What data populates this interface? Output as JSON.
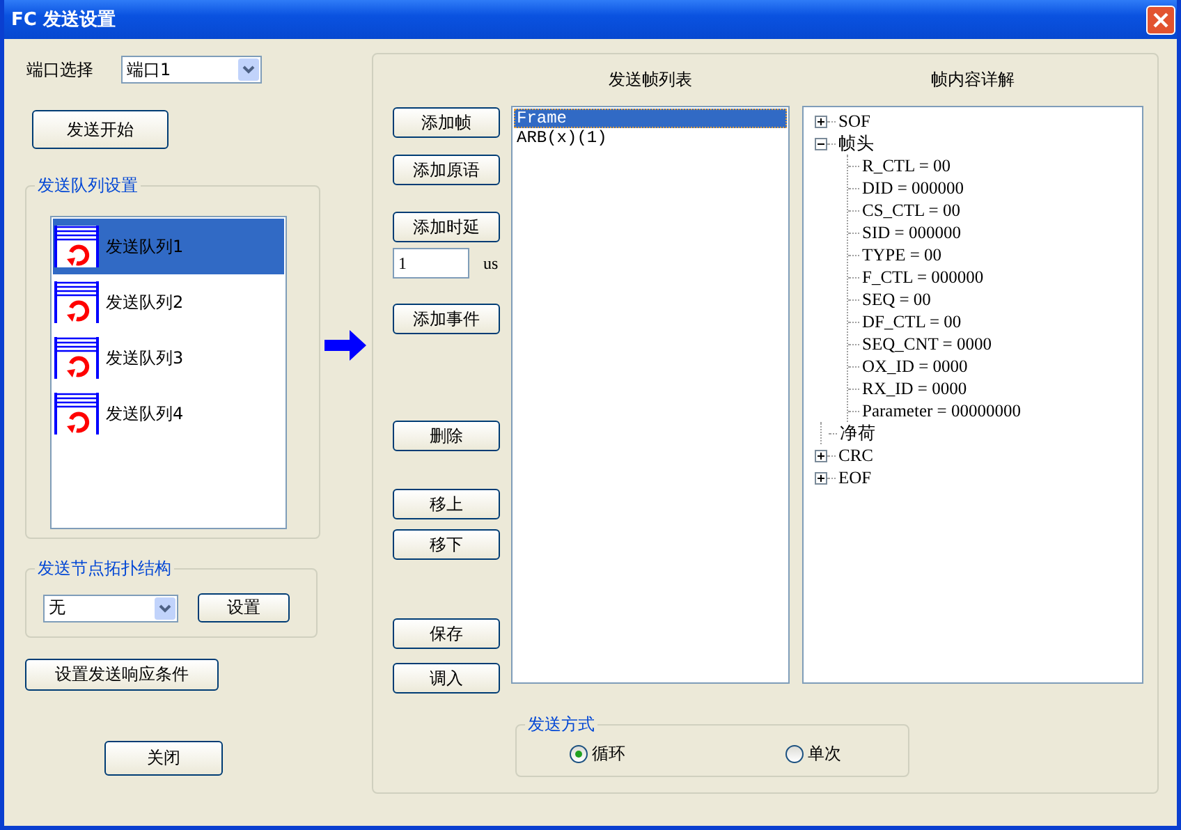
{
  "window": {
    "title": "FC 发送设置"
  },
  "port": {
    "label": "端口选择",
    "value": "端口1"
  },
  "start_button": "发送开始",
  "queue_group": {
    "title": "发送队列设置",
    "items": [
      {
        "label": "发送队列1",
        "selected": true
      },
      {
        "label": "发送队列2",
        "selected": false
      },
      {
        "label": "发送队列3",
        "selected": false
      },
      {
        "label": "发送队列4",
        "selected": false
      }
    ]
  },
  "topology_group": {
    "title": "发送节点拓扑结构",
    "value": "无",
    "button": "设置"
  },
  "response_button": "设置发送响应条件",
  "close_button": "关闭",
  "actions": [
    {
      "kind": "button",
      "label": "添加帧"
    },
    {
      "kind": "button",
      "label": "添加原语"
    },
    {
      "kind": "button",
      "label": "添加时延"
    },
    {
      "kind": "input",
      "value": "1",
      "unit": "us"
    },
    {
      "kind": "button",
      "label": "添加事件"
    },
    {
      "kind": "button",
      "label": "删除"
    },
    {
      "kind": "button",
      "label": "移上"
    },
    {
      "kind": "button",
      "label": "移下"
    },
    {
      "kind": "button",
      "label": "保存"
    },
    {
      "kind": "button",
      "label": "调入"
    }
  ],
  "frame_list": {
    "heading": "发送帧列表",
    "items": [
      {
        "label": "Frame",
        "selected": true
      },
      {
        "label": "ARB(x)(1)",
        "selected": false
      }
    ]
  },
  "frame_detail": {
    "heading": "帧内容详解",
    "tree": [
      {
        "kind": "folder",
        "label": "SOF",
        "expanded": false
      },
      {
        "kind": "folder",
        "label": "帧头",
        "expanded": true,
        "children": [
          {
            "label": "R_CTL = 00"
          },
          {
            "label": "DID = 000000"
          },
          {
            "label": "CS_CTL = 00"
          },
          {
            "label": "SID = 000000"
          },
          {
            "label": "TYPE = 00"
          },
          {
            "label": "F_CTL = 000000"
          },
          {
            "label": "SEQ = 00"
          },
          {
            "label": "DF_CTL = 00"
          },
          {
            "label": "SEQ_CNT = 0000"
          },
          {
            "label": "OX_ID = 0000"
          },
          {
            "label": "RX_ID = 0000"
          },
          {
            "label": "Parameter = 00000000"
          }
        ]
      },
      {
        "kind": "leaf",
        "label": "净荷"
      },
      {
        "kind": "folder",
        "label": "CRC",
        "expanded": false
      },
      {
        "kind": "folder",
        "label": "EOF",
        "expanded": false
      }
    ]
  },
  "send_mode": {
    "title": "发送方式",
    "options": [
      {
        "label": "循环",
        "selected": true
      },
      {
        "label": "单次",
        "selected": false
      }
    ]
  }
}
